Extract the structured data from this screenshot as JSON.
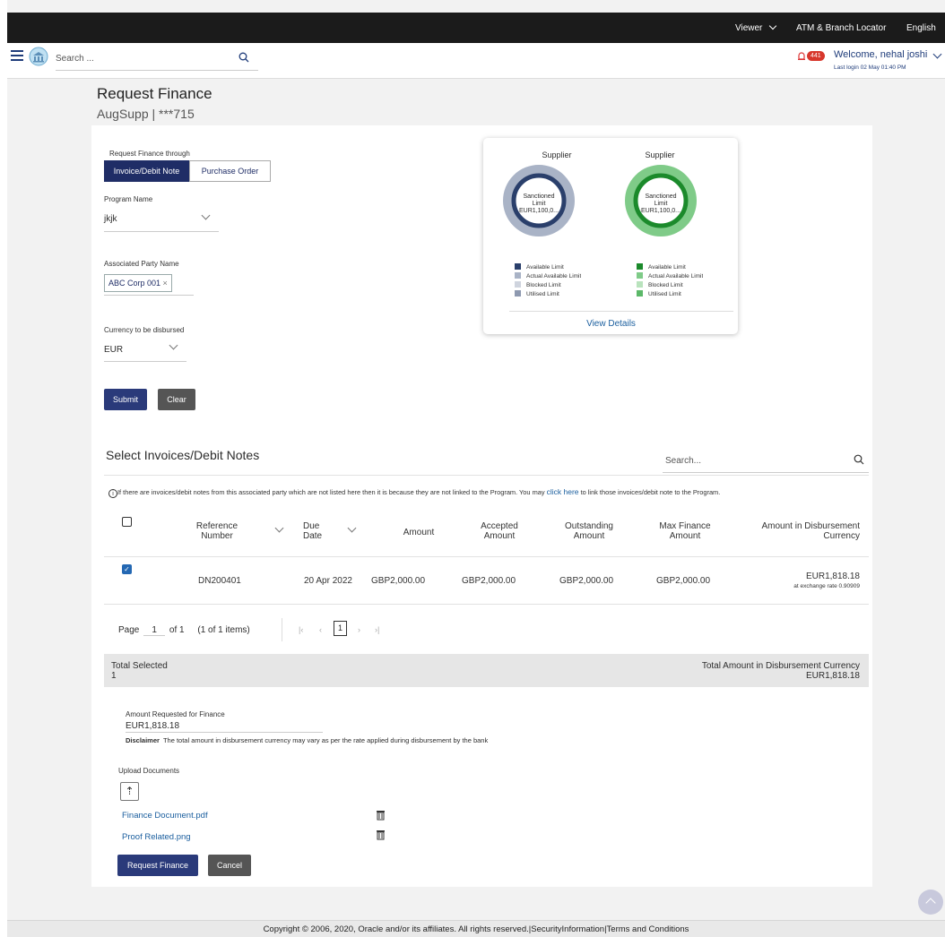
{
  "topbar": {
    "viewer": "Viewer",
    "atm": "ATM & Branch Locator",
    "language": "English"
  },
  "header": {
    "search_placeholder": "Search ...",
    "notification_count": "441",
    "welcome": "Welcome, nehal joshi",
    "last_login": "Last login 02 May 01:40 PM"
  },
  "page": {
    "title": "Request Finance",
    "subtitle": "AugSupp | ***715"
  },
  "form": {
    "through_label": "Request Finance through",
    "tab_invoice": "Invoice/Debit Note",
    "tab_po": "Purchase Order",
    "program_label": "Program Name",
    "program_value": "jkjk",
    "party_label": "Associated Party Name",
    "party_chip": "ABC Corp 001",
    "currency_label": "Currency to be disbursed",
    "currency_value": "EUR",
    "submit": "Submit",
    "clear": "Clear"
  },
  "limits": {
    "cards": [
      {
        "title": "Supplier",
        "center_line1": "Sanctioned",
        "center_line2": "Limit",
        "center_line3": "EUR1,100,0...",
        "colors": [
          "#2a3f6b",
          "#a9b3c6",
          "#cfd4de"
        ]
      },
      {
        "title": "Supplier",
        "center_line1": "Sanctioned",
        "center_line2": "Limit",
        "center_line3": "EUR1,100,0...",
        "colors": [
          "#1b8a2b",
          "#7fcb88",
          "#b9e3bd"
        ]
      }
    ],
    "legend": [
      "Available Limit",
      "Actual Available Limit",
      "Blocked Limit",
      "Utilised Limit"
    ],
    "view_details": "View Details"
  },
  "invoices": {
    "title": "Select Invoices/Debit Notes",
    "search_placeholder": "Search...",
    "info_pre": "If there are invoices/debit notes from this associated party which are not listed here then it is because they are not linked to the Program. You may ",
    "info_link": "click here",
    "info_post": " to link those invoices/debit note to the Program.",
    "columns": {
      "ref1": "Reference",
      "ref2": "Number",
      "due1": "Due",
      "due2": "Date",
      "amount": "Amount",
      "acc1": "Accepted",
      "acc2": "Amount",
      "out1": "Outstanding",
      "out2": "Amount",
      "max1": "Max Finance",
      "max2": "Amount",
      "disb1": "Amount in Disbursement",
      "disb2": "Currency"
    },
    "row": {
      "ref": "DN200401",
      "due": "20 Apr 2022",
      "amount": "GBP2,000.00",
      "accepted": "GBP2,000.00",
      "outstanding": "GBP2,000.00",
      "max": "GBP2,000.00",
      "disb": "EUR1,818.18",
      "rate": "at exchange rate 0.90909"
    },
    "pagination": {
      "page_label": "Page",
      "page": "1",
      "of": "of 1",
      "items": "(1 of 1 items)",
      "current": "1"
    },
    "total_selected_label": "Total Selected",
    "total_selected": "1",
    "total_amount_label": "Total Amount in Disbursement Currency",
    "total_amount": "EUR1,818.18"
  },
  "finance": {
    "amount_label": "Amount Requested for Finance",
    "amount": "EUR1,818.18",
    "disclaimer_label": "Disclaimer",
    "disclaimer": "The total amount in disbursement currency may vary as per the rate applied during disbursement by the bank",
    "upload_label": "Upload Documents",
    "documents": [
      "Finance Document.pdf",
      "Proof Related.png"
    ],
    "request_btn": "Request Finance",
    "cancel_btn": "Cancel"
  },
  "footer": {
    "text": "Copyright © 2006, 2020, Oracle and/or its affiliates. All rights reserved.|SecurityInformation|Terms and Conditions"
  }
}
